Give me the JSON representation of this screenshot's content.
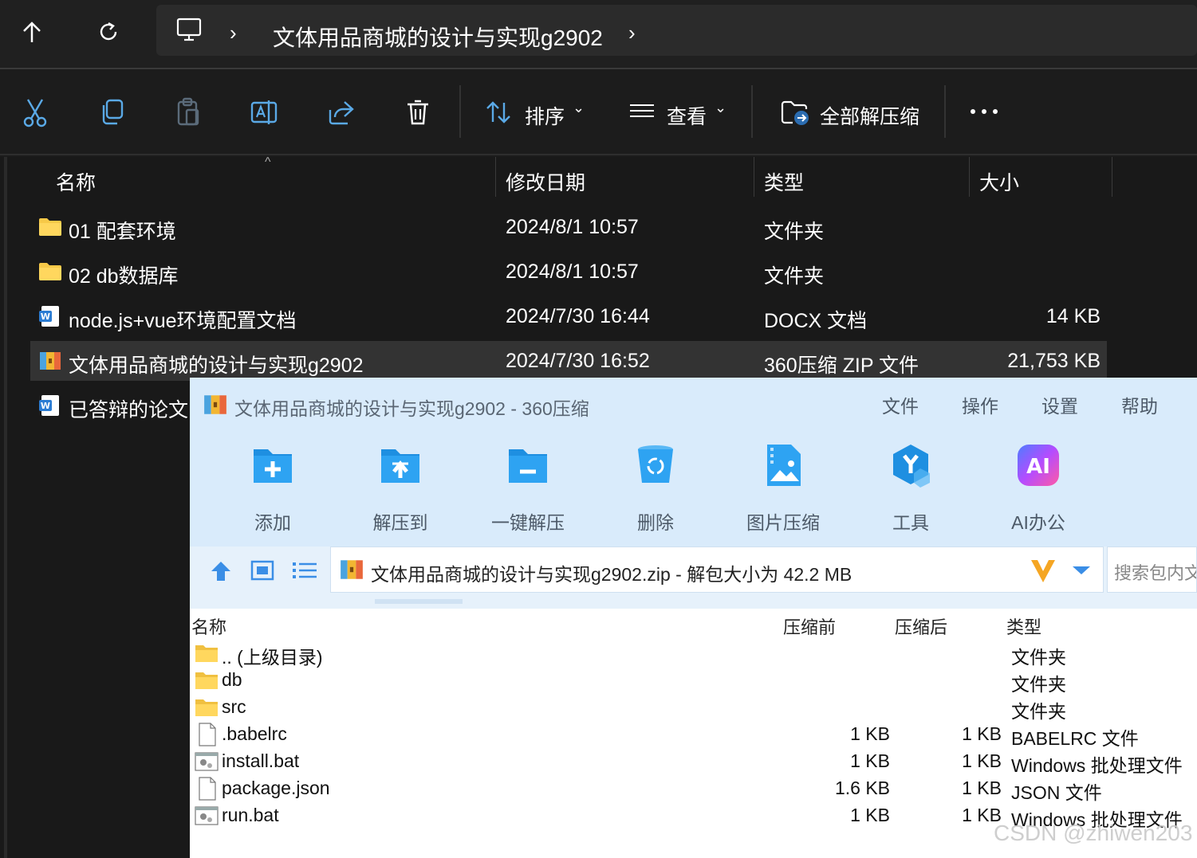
{
  "address_bar": {
    "path": "文体用品商城的设计与实现g2902",
    "nav": [
      "up-arrow-icon",
      "refresh-icon"
    ]
  },
  "toolbar": {
    "sort_label": "排序",
    "view_label": "查看",
    "extract_all_label": "全部解压缩"
  },
  "columns": {
    "name": "名称",
    "date": "修改日期",
    "type": "类型",
    "size": "大小"
  },
  "files": [
    {
      "name": "01 配套环境",
      "date": "2024/8/1 10:57",
      "type": "文件夹",
      "size": "",
      "icon": "folder-icon"
    },
    {
      "name": "02 db数据库",
      "date": "2024/8/1 10:57",
      "type": "文件夹",
      "size": "",
      "icon": "folder-icon"
    },
    {
      "name": "node.js+vue环境配置文档",
      "date": "2024/7/30 16:44",
      "type": "DOCX 文档",
      "size": "14 KB",
      "icon": "word-doc-icon"
    },
    {
      "name": "文体用品商城的设计与实现g2902",
      "date": "2024/7/30 16:52",
      "type": "360压缩 ZIP 文件",
      "size": "21,753 KB",
      "icon": "zip-archive-icon",
      "selected": true
    },
    {
      "name": "已答辩的论文",
      "date": "",
      "type": "",
      "size": "",
      "icon": "word-doc-icon"
    }
  ],
  "zip": {
    "title": "文体用品商城的设计与实现g2902 - 360压缩",
    "menu": [
      "文件",
      "操作",
      "设置",
      "帮助"
    ],
    "tools": [
      {
        "label": "添加",
        "icon": "add-folder-icon"
      },
      {
        "label": "解压到",
        "icon": "extract-to-icon"
      },
      {
        "label": "一键解压",
        "icon": "one-click-extract-icon"
      },
      {
        "label": "删除",
        "icon": "recycle-bin-icon"
      },
      {
        "label": "图片压缩",
        "icon": "image-compress-icon"
      },
      {
        "label": "工具",
        "icon": "tools-icon"
      },
      {
        "label": "AI办公",
        "icon": "ai-office-icon"
      }
    ],
    "path": "文体用品商城的设计与实现g2902.zip - 解包大小为 42.2 MB",
    "search_placeholder": "搜索包内文",
    "columns": {
      "name": "名称",
      "before": "压缩前",
      "after": "压缩后",
      "type": "类型"
    },
    "entries": [
      {
        "name": ".. (上级目录)",
        "before": "",
        "after": "",
        "type": "文件夹",
        "icon": "folder-icon"
      },
      {
        "name": "db",
        "before": "",
        "after": "",
        "type": "文件夹",
        "icon": "folder-icon"
      },
      {
        "name": "src",
        "before": "",
        "after": "",
        "type": "文件夹",
        "icon": "folder-icon"
      },
      {
        "name": ".babelrc",
        "before": "1 KB",
        "after": "1 KB",
        "type": "BABELRC 文件",
        "icon": "file-icon"
      },
      {
        "name": "install.bat",
        "before": "1 KB",
        "after": "1 KB",
        "type": "Windows 批处理文件",
        "icon": "batch-file-icon"
      },
      {
        "name": "package.json",
        "before": "1.6 KB",
        "after": "1 KB",
        "type": "JSON 文件",
        "icon": "file-icon"
      },
      {
        "name": "run.bat",
        "before": "1 KB",
        "after": "1 KB",
        "type": "Windows 批处理文件",
        "icon": "batch-file-icon"
      }
    ]
  },
  "watermark": "CSDN @zhiwen203",
  "colors": {
    "dark_bg": "#191919",
    "selected_row": "#333333",
    "zip_header_bg": "#d9ebfb",
    "zip_blue": "#1e90ff"
  }
}
